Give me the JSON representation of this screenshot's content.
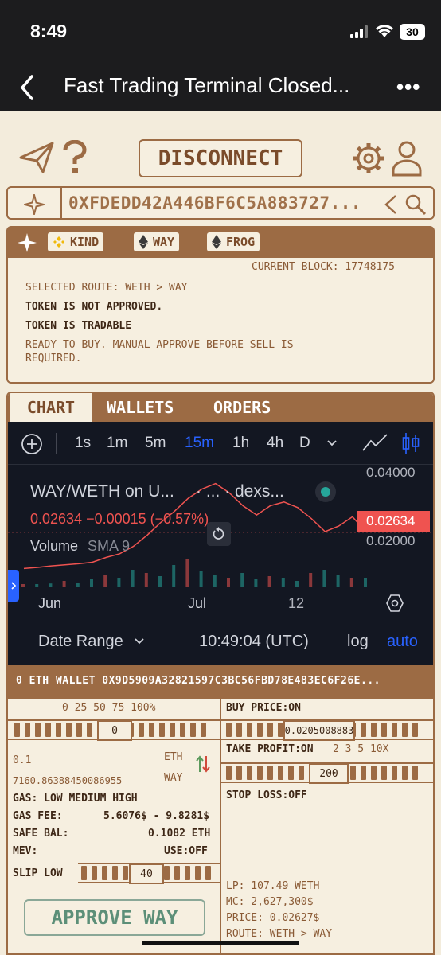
{
  "status": {
    "time": "8:49",
    "battery": "30"
  },
  "nav": {
    "title": "Fast Trading Terminal Closed..."
  },
  "header": {
    "disconnect_label": "DISCONNECT"
  },
  "address_bar": {
    "address": "0XFDEDD42A446BF6C5A883727..."
  },
  "panel": {
    "chips": [
      "KIND",
      "WAY",
      "FROG"
    ],
    "current_block": "CURRENT BLOCK: 17748175",
    "selected_route": "SELECTED ROUTE: WETH > WAY",
    "not_approved": "TOKEN IS NOT APPROVED.",
    "tradable": "TOKEN IS TRADABLE",
    "ready_line1": "READY TO BUY. MANUAL APPROVE BEFORE SELL IS",
    "ready_line2": "REQUIRED."
  },
  "tabs": [
    "CHART",
    "WALLETS",
    "ORDERS"
  ],
  "chart": {
    "timeframes": [
      "1s",
      "1m",
      "5m",
      "15m",
      "1h",
      "4h",
      "D"
    ],
    "active_timeframe": "15m",
    "symbol": "WAY/WETH on U...",
    "symbol_rest": "· ... · dexs...",
    "price_line": "0.02634 −0.00015 (−0.57%)",
    "volume_label": "Volume",
    "sma_label": "SMA 9",
    "current_price_tag": "0.02634",
    "date_range_label": "Date Range",
    "time_utc": "10:49:04 (UTC)",
    "log_label": "log",
    "auto_label": "auto",
    "colors": {
      "up": "#26a69a",
      "down": "#ef5350",
      "active": "#2962ff"
    }
  },
  "chart_data": {
    "type": "line",
    "title": "WAY/WETH on U...",
    "x_ticks": [
      "Jun",
      "Jul",
      "12"
    ],
    "y_ticks": [
      "0.04000",
      "0.02000"
    ],
    "ylim": [
      0.014,
      0.042
    ],
    "x": [
      0,
      4,
      8,
      12,
      16,
      20,
      24,
      28,
      32,
      36,
      40,
      44,
      48,
      52,
      56,
      60,
      64,
      68,
      72,
      76,
      80,
      84,
      88,
      92,
      96,
      100
    ],
    "series": [
      {
        "values": [
          0.0165,
          0.0168,
          0.0172,
          0.0175,
          0.0178,
          0.0182,
          0.0195,
          0.0205,
          0.0225,
          0.0255,
          0.029,
          0.032,
          0.0355,
          0.038,
          0.0395,
          0.037,
          0.0335,
          0.031,
          0.0335,
          0.0345,
          0.033,
          0.03,
          0.0265,
          0.028,
          0.0305,
          0.02634
        ]
      }
    ],
    "last_value": 0.02634,
    "volume": [
      0.1,
      0.1,
      0.12,
      0.2,
      0.15,
      0.25,
      0.4,
      0.3,
      0.55,
      0.45,
      0.35,
      0.7,
      0.9,
      0.5,
      0.4,
      0.3,
      0.45,
      0.25,
      0.35,
      0.3,
      0.2,
      0.45,
      0.55,
      0.4,
      0.3,
      0.3
    ]
  },
  "wallet_band": {
    "text": "0 ETH WALLET 0X9D5909A32821597C3BC56FBD78E483EC6F26E..."
  },
  "left": {
    "pct_labels": "0 25 50 75 100%",
    "slider_value": "0",
    "amount": "0.1",
    "amount_unit": "ETH",
    "receive": "7160.86388450086955",
    "receive_unit": "WAY",
    "gas": "GAS: LOW MEDIUM HIGH",
    "gas_fee_label": "GAS FEE:",
    "gas_fee_value": "5.6076$ - 9.8281$",
    "safe_bal_label": "SAFE BAL:",
    "safe_bal_value": "0.1082 ETH",
    "mev_label": "MEV:",
    "mev_value": "USE:OFF",
    "slip_label": "SLIP LOW",
    "slip_value": "40",
    "approve_label": "APPROVE WAY"
  },
  "right": {
    "buy_price": "BUY PRICE:ON",
    "buy_price_value": "0.0205008883",
    "take_profit": "TAKE PROFIT:ON",
    "tp_options": "2  3  5  10X",
    "tp_value": "200",
    "stop_loss": "STOP LOSS:OFF",
    "lp": "LP: 107.49 WETH",
    "mc": "MC: 2,627,300$",
    "price": "PRICE: 0.02627$",
    "route": "ROUTE: WETH > WAY"
  }
}
